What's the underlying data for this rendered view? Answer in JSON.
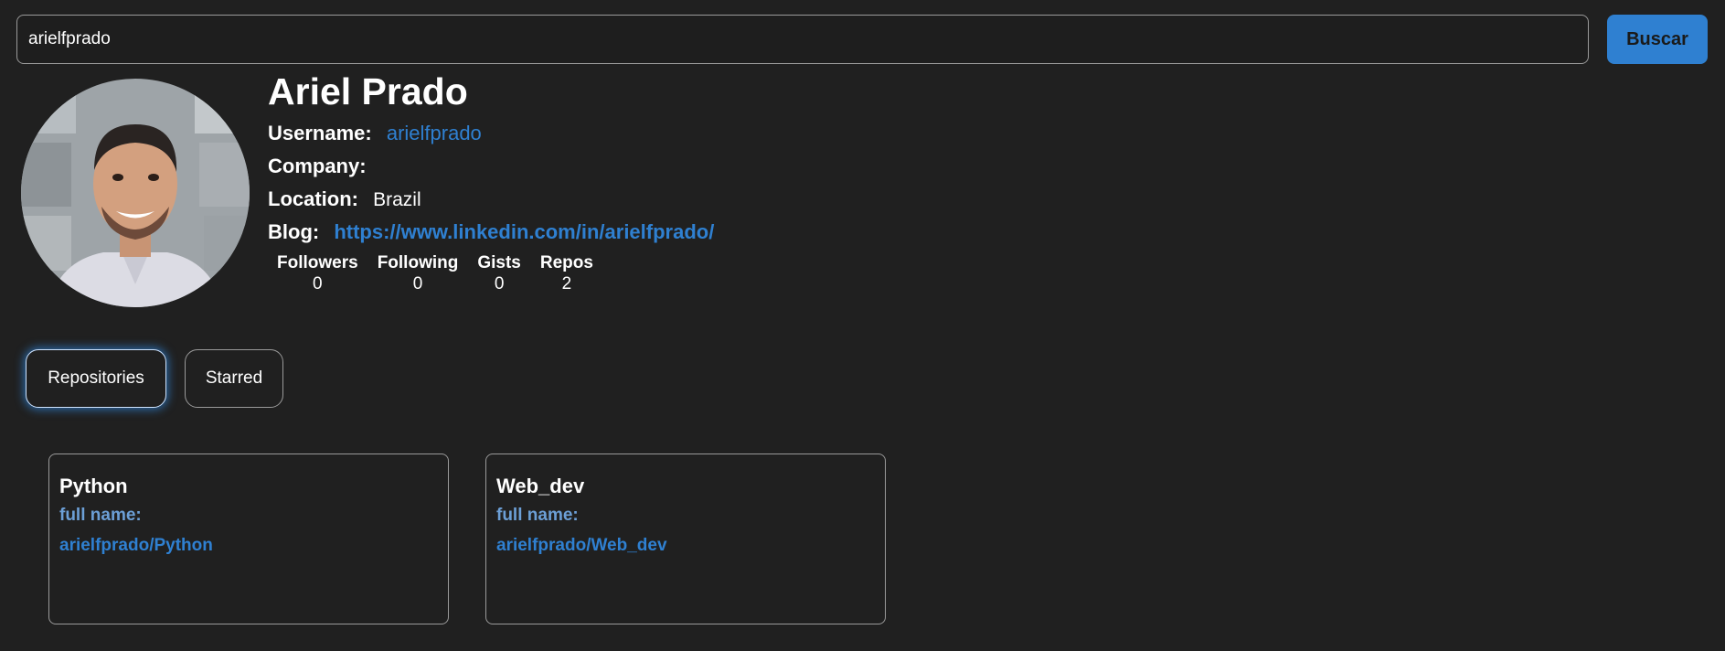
{
  "search": {
    "value": "arielfprado",
    "button_label": "Buscar"
  },
  "profile": {
    "name": "Ariel Prado",
    "username_label": "Username:",
    "username": "arielfprado",
    "company_label": "Company:",
    "company": "",
    "location_label": "Location:",
    "location": "Brazil",
    "blog_label": "Blog:",
    "blog": "https://www.linkedin.com/in/arielfprado/"
  },
  "stats": [
    {
      "label": "Followers",
      "value": "0"
    },
    {
      "label": "Following",
      "value": "0"
    },
    {
      "label": "Gists",
      "value": "0"
    },
    {
      "label": "Repos",
      "value": "2"
    }
  ],
  "tabs": [
    {
      "label": "Repositories",
      "active": true
    },
    {
      "label": "Starred",
      "active": false
    }
  ],
  "repos": [
    {
      "name": "Python",
      "full_name_label": "full name:",
      "full_name": "arielfprado/Python"
    },
    {
      "name": "Web_dev",
      "full_name_label": "full name:",
      "full_name": "arielfprado/Web_dev"
    }
  ],
  "colors": {
    "background": "#202020",
    "accent": "#2f80d1",
    "border": "#9a9a9a"
  },
  "icons": {
    "avatar": "user-photo"
  }
}
